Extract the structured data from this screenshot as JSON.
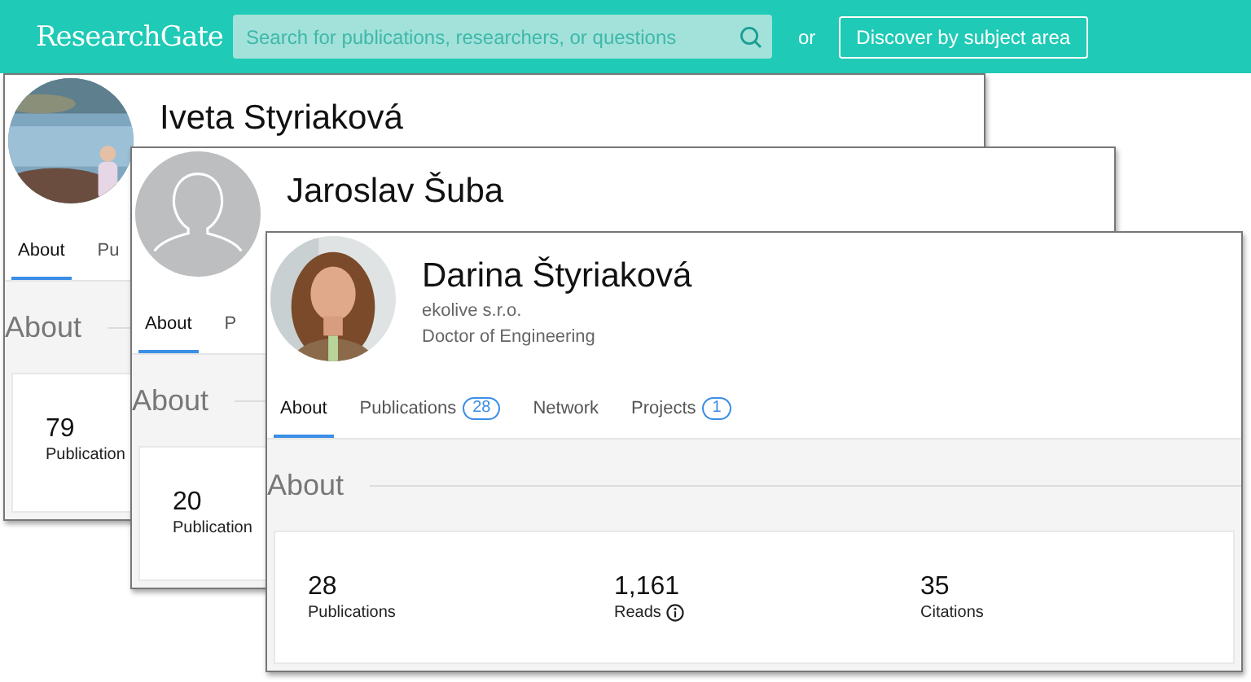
{
  "header": {
    "logo": "ResearchGate",
    "search": {
      "placeholder": "Search for publications, researchers, or questions"
    },
    "separator": "or",
    "button": "Discover by subject area"
  },
  "profiles": [
    {
      "name": "Iveta Styriaková",
      "avatar": {
        "kind": "picture"
      },
      "tabs": [
        {
          "label": "About",
          "selected": true
        },
        {
          "label": "Pu",
          "selected": false
        }
      ],
      "section_title": "About",
      "stats": [
        {
          "value": "79",
          "label": "Publication"
        }
      ]
    },
    {
      "name": "Jaroslav Šuba",
      "avatar": {
        "kind": "silhouette"
      },
      "tabs": [
        {
          "label": "About",
          "selected": true
        },
        {
          "label": "P",
          "selected": false
        }
      ],
      "section_title": "About",
      "stats": [
        {
          "value": "20",
          "label": "Publication"
        }
      ]
    },
    {
      "name": "Darina Štyriaková",
      "affiliation": "ekolive s.r.o.",
      "degree": "Doctor of Engineering",
      "avatar": {
        "kind": "picture"
      },
      "tabs": [
        {
          "label": "About",
          "selected": true
        },
        {
          "label": "Publications",
          "count": "28",
          "selected": false
        },
        {
          "label": "Network",
          "selected": false
        },
        {
          "label": "Projects",
          "count": "1",
          "selected": false
        }
      ],
      "section_title": "About",
      "stats": [
        {
          "value": "28",
          "label": "Publications"
        },
        {
          "value": "1,161",
          "label": "Reads",
          "info": true
        },
        {
          "value": "35",
          "label": "Citations"
        }
      ]
    }
  ]
}
